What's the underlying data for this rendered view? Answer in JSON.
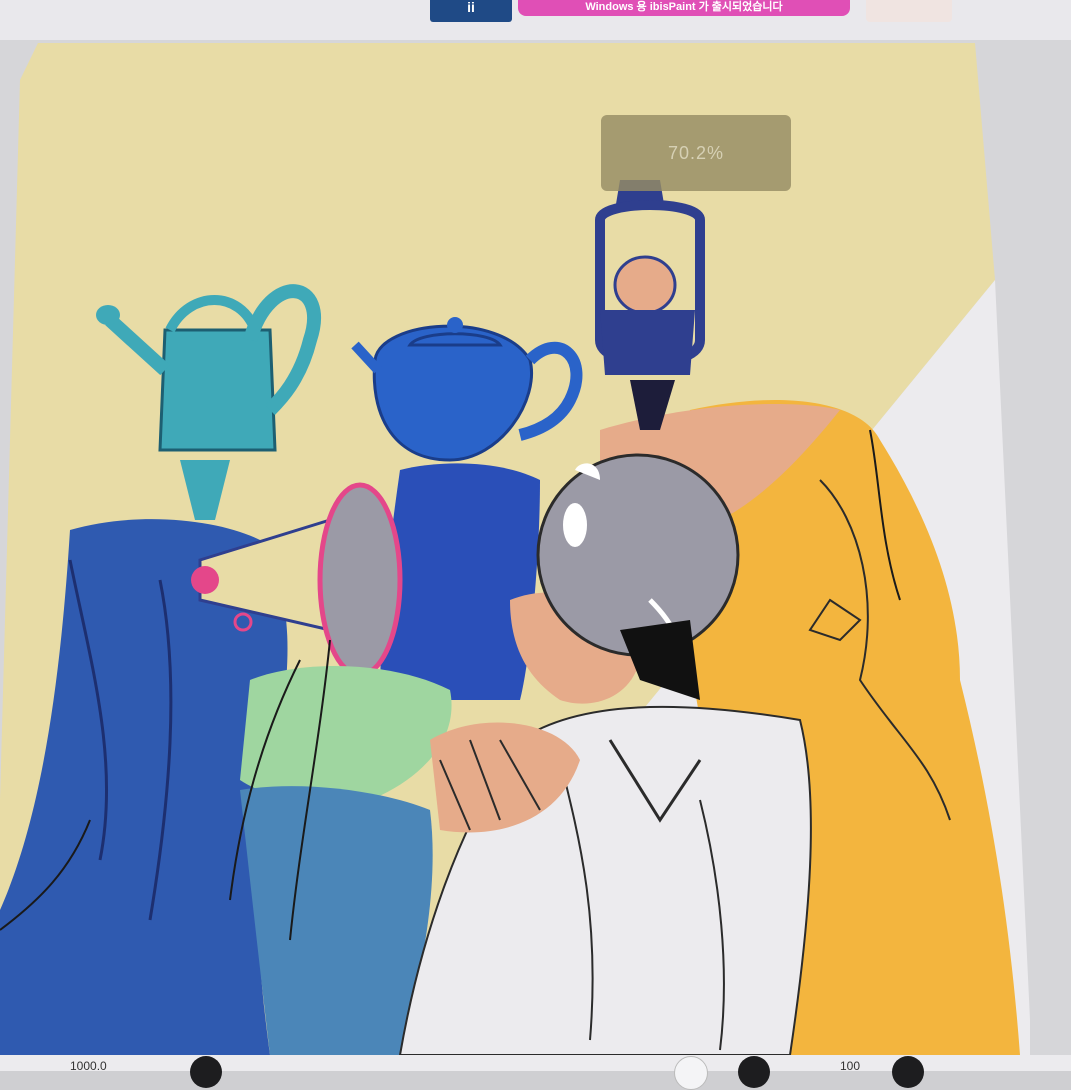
{
  "header": {
    "app_badge": "ii",
    "ad_text": "Windows 용 ibisPaint 가 출시되었습니다"
  },
  "canvas": {
    "zoom_level": "70.2%"
  },
  "footer": {
    "left_value": "1000.0",
    "right_value": "100"
  },
  "colors": {
    "background_yellow": "#e8dca6",
    "white_panel": "#ecebee",
    "orange": "#f3b53e",
    "navy": "#2f3f8f",
    "blue": "#2a63c9",
    "teal": "#3fa9b8",
    "mint": "#9fd6a0",
    "pink": "#e4478a",
    "skin": "#e6ab8a",
    "grey_helmet": "#9b9aa6"
  },
  "icons": [
    "undo-icon",
    "layer-icon",
    "add-icon",
    "menu-icon"
  ]
}
